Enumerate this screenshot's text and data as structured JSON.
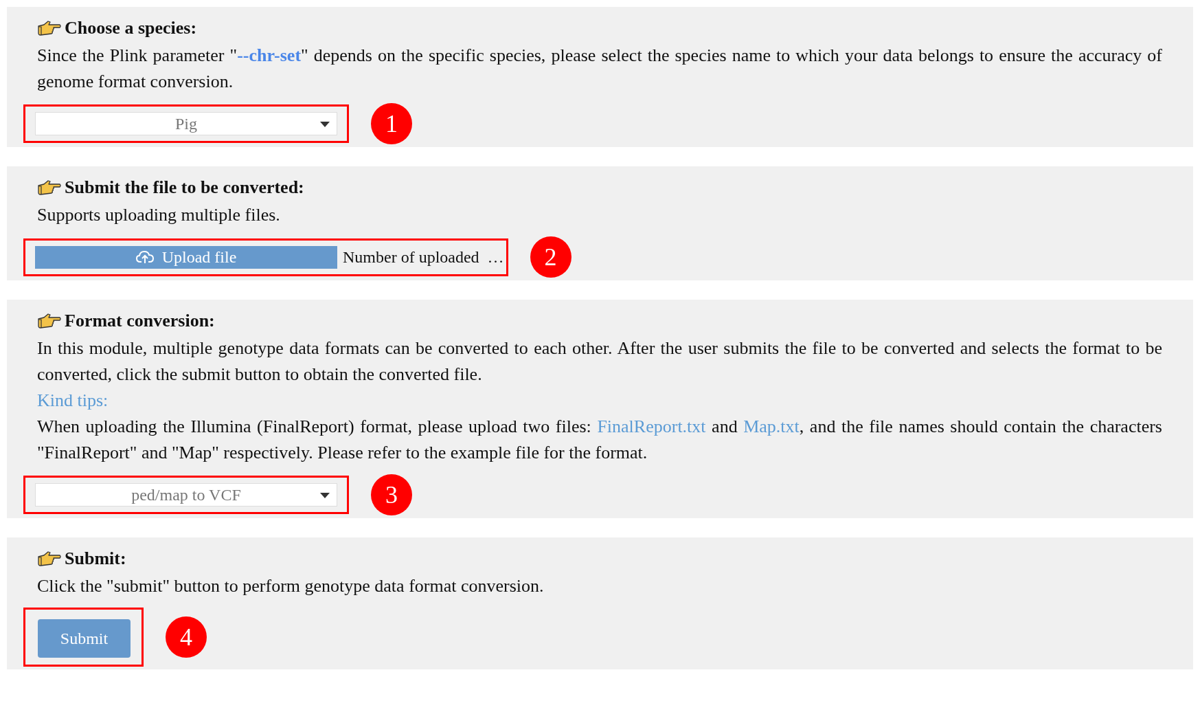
{
  "sections": [
    {
      "kind": "select",
      "title": "Choose a species:",
      "paragraphs": [
        [
          {
            "kind": "text",
            "text": "Since the Plink parameter \""
          },
          {
            "kind": "keyword",
            "text": "--chr-set"
          },
          {
            "kind": "text",
            "text": "\" depends on the specific species, please select the species name to which your data belongs to ensure the accuracy of genome format conversion."
          }
        ]
      ],
      "control": {
        "value": "Pig"
      },
      "marker": "1"
    },
    {
      "kind": "upload",
      "title": "Submit the file to be converted:",
      "paragraphs": [
        [
          {
            "kind": "text",
            "text": "Supports uploading multiple files."
          }
        ]
      ],
      "control": {
        "label": "Upload file",
        "status": "Number of uploaded  …"
      },
      "marker": "2"
    },
    {
      "kind": "select",
      "title": "Format conversion:",
      "paragraphs": [
        [
          {
            "kind": "text",
            "text": "In this module, multiple genotype data formats can be converted to each other. After the user submits the file to be converted and selects the format to be converted, click the submit button to obtain the converted file."
          }
        ],
        [
          {
            "kind": "tip",
            "text": "Kind tips:"
          }
        ],
        [
          {
            "kind": "text",
            "text": "When uploading the Illumina (FinalReport) format, please upload two files: "
          },
          {
            "kind": "link",
            "text": "FinalReport.txt"
          },
          {
            "kind": "text",
            "text": " and "
          },
          {
            "kind": "link",
            "text": "Map.txt"
          },
          {
            "kind": "text",
            "text": ", and the file names should contain the characters \"FinalReport\" and \"Map\" respectively. Please refer to the example file for the format."
          }
        ]
      ],
      "control": {
        "value": "ped/map to VCF"
      },
      "marker": "3"
    },
    {
      "kind": "submit",
      "title": "Submit:",
      "paragraphs": [
        [
          {
            "kind": "text",
            "text": "Click the \"submit\" button to perform genotype data format conversion."
          }
        ]
      ],
      "control": {
        "label": "Submit"
      },
      "marker": "4"
    }
  ]
}
